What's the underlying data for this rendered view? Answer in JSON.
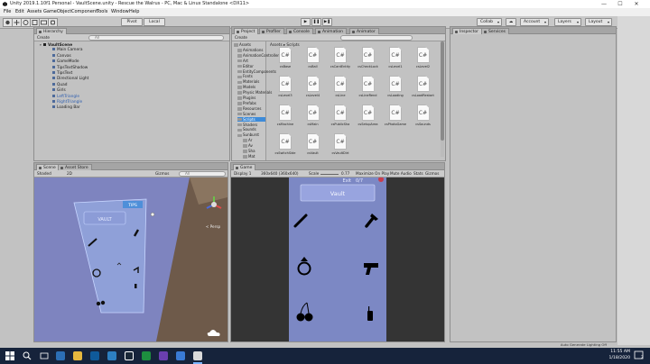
{
  "window": {
    "title": "Unity 2019.1.10f1 Personal - VaultScene.unity - Rescue the Walrus - PC, Mac & Linux Standalone <DX11>",
    "minimize_glyph": "—",
    "maximize_glyph": "☐",
    "close_glyph": "✕"
  },
  "menu": [
    "File",
    "Edit",
    "Assets",
    "GameObject",
    "Component",
    "Tools",
    "Window",
    "Help"
  ],
  "toolbar": {
    "pivot_label": "Pivot",
    "local_label": "Local",
    "play_glyph": "▶",
    "pause_glyph": "❚❚",
    "step_glyph": "▶❚",
    "collab_label": "Collab",
    "account_label": "Account",
    "layers_label": "Layers",
    "layout_label": "Layout"
  },
  "hierarchy": {
    "tab": "Hierarchy",
    "create_label": "Create",
    "search_placeholder": "All",
    "items": [
      {
        "label": "VaultScene",
        "depth": 0
      },
      {
        "label": "Main Camera",
        "depth": 1
      },
      {
        "label": "Canvas",
        "depth": 1
      },
      {
        "label": "GameMode",
        "depth": 1
      },
      {
        "label": "TipsTextShadow",
        "depth": 1
      },
      {
        "label": "TipsText",
        "depth": 1
      },
      {
        "label": "Directional Light",
        "depth": 1
      },
      {
        "label": "Quad",
        "depth": 1
      },
      {
        "label": "Girls",
        "depth": 1
      },
      {
        "label": "LeftTriangle",
        "depth": 1
      },
      {
        "label": "RightTriangle",
        "depth": 1
      },
      {
        "label": "Loading Bar",
        "depth": 1
      }
    ]
  },
  "project": {
    "tabs": [
      "Project",
      "Profiler",
      "Console",
      "Animation",
      "Animator"
    ],
    "create_label": "Create",
    "breadcrumb": [
      "Assets",
      "Scripts"
    ],
    "tree": [
      "Assets",
      "Animations",
      "AnimationController",
      "Art",
      "Editor",
      "EntityComponents",
      "Fonts",
      "Materials",
      "Models",
      "Physic Materials",
      "Plugins",
      "Prefabs",
      "Resources",
      "Scenes",
      "Scripts",
      "Shaders",
      "Sounds",
      "Sunburst",
      "Ar",
      "Av",
      "Sha",
      "Mat"
    ],
    "selected_tree": "Scripts",
    "file_glyph": "C#",
    "files": [
      "csBase",
      "csBall",
      "csCardEntity",
      "csCheckLock",
      "csLevel1",
      "csLevel2",
      "csLevel3",
      "csLevel4",
      "csLine",
      "csLineRend",
      "csLoading",
      "csLoadRestart",
      "csMachine",
      "csMain",
      "csPublicSha",
      "csSetupArea",
      "csPhotoGame",
      "csSounds",
      "csSwitchSide",
      "csVault",
      "csVaultDirt"
    ]
  },
  "inspector": {
    "tabs": [
      "Inspector",
      "Services"
    ]
  },
  "scene": {
    "tabs": [
      "Scene",
      "Asset Store"
    ],
    "shading": "Shaded",
    "mode_2d": "2D",
    "gizmos_label": "Gizmos",
    "search_placeholder": "All",
    "persp_label": "< Persp",
    "vault_label": "VAULT",
    "title_tag": "TIPS"
  },
  "game": {
    "tab": "Game",
    "display": "Display 1",
    "resolution": "360x640 (360x640)",
    "scale_label": "Scale",
    "scale_value": "0.77",
    "maximize": "Maximize On Play",
    "mute": "Mute Audio",
    "stats": "Stats",
    "gizmos": "Gizmos",
    "exit_label": "Exit",
    "exit_count": "0/7",
    "vault_button": "Vault"
  },
  "status": {
    "right_text": "Auto Generate Lighting Off"
  },
  "taskbar": {
    "time": "11:55 AM",
    "date": "1/18/2020",
    "notification_count": "2"
  },
  "colors": {
    "accent": "#3d8bd9",
    "scene_bg": "#7e84bf",
    "game_bg": "#7c88c4",
    "taskbar": "#16233b"
  }
}
